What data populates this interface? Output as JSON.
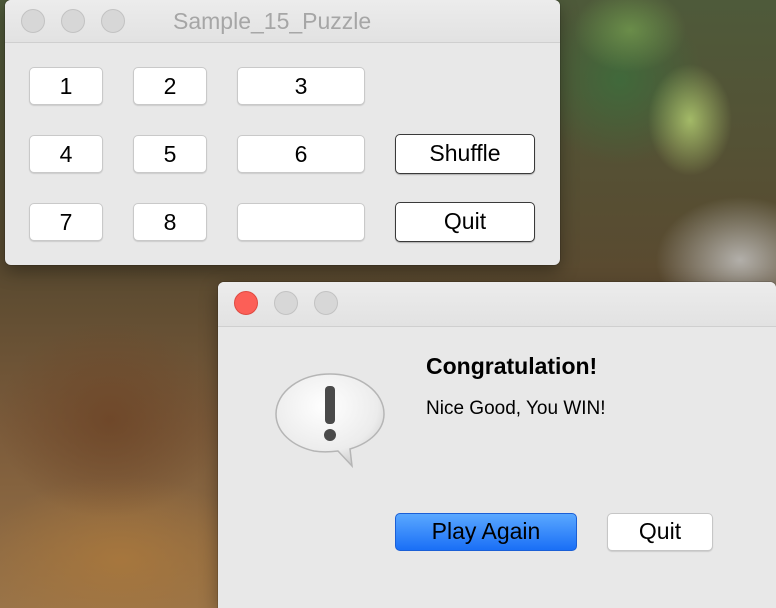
{
  "puzzle_window": {
    "title": "Sample_15_Puzzle",
    "tiles": [
      "1",
      "2",
      "3",
      "4",
      "5",
      "6",
      "7",
      "8",
      ""
    ],
    "shuffle_label": "Shuffle",
    "quit_label": "Quit"
  },
  "alert_window": {
    "icon": "exclamation-speech-bubble-icon",
    "heading": "Congratulation!",
    "message": "Nice Good, You WIN!",
    "play_again_label": "Play Again",
    "quit_label": "Quit"
  },
  "colors": {
    "primary_button": "#1a6ff6",
    "close_button": "#fc5f57"
  }
}
